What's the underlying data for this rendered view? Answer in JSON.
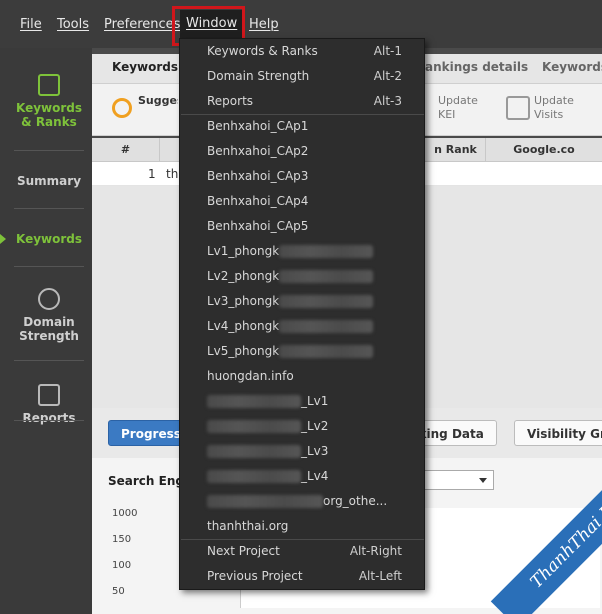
{
  "menubar": {
    "items": [
      "File",
      "Tools",
      "Preferences",
      "Window",
      "Help"
    ]
  },
  "sidebar": {
    "items": [
      {
        "label": "Keywords & Ranks",
        "icon": "chart-icon"
      },
      {
        "label": "Summary",
        "icon": ""
      },
      {
        "label": "Keywords",
        "icon": ""
      },
      {
        "label": "Domain Strength",
        "icon": "gauge-icon"
      },
      {
        "label": "Reports",
        "icon": "report-icon"
      }
    ]
  },
  "tabs": [
    "Keywords &",
    "ankings details",
    "Keywords"
  ],
  "toolbar": {
    "suggest": "Suggest Keyword",
    "update_kei": "Update KEI",
    "update_visits": "Update Visits"
  },
  "grid": {
    "headers": [
      "#",
      "n Rank",
      "Google.co"
    ],
    "row": {
      "num": "1",
      "keyword": "tha"
    }
  },
  "bottom": {
    "tabs": [
      "Progress",
      "nking Data",
      "Visibility Gra"
    ],
    "search_label": "Search Engin",
    "yticks": [
      "1000",
      "150",
      "100",
      "50"
    ]
  },
  "dropdown": {
    "top_items": [
      {
        "label": "Keywords & Ranks",
        "shortcut": "Alt-1"
      },
      {
        "label": "Domain Strength",
        "shortcut": "Alt-2"
      },
      {
        "label": "Reports",
        "shortcut": "Alt-3"
      }
    ],
    "projects": [
      {
        "label": "Benhxahoi_CAp1"
      },
      {
        "label": "Benhxahoi_CAp2"
      },
      {
        "label": "Benhxahoi_CAp3"
      },
      {
        "label": "Benhxahoi_CAp4"
      },
      {
        "label": "Benhxahoi_CAp5"
      },
      {
        "label": "Lv1_phongk"
      },
      {
        "label": "Lv2_phongk"
      },
      {
        "label": "Lv3_phongk"
      },
      {
        "label": "Lv4_phongk"
      },
      {
        "label": "Lv5_phongk"
      },
      {
        "label": "huongdan.info"
      },
      {
        "label": "_Lv1"
      },
      {
        "label": "_Lv2"
      },
      {
        "label": "_Lv3"
      },
      {
        "label": "_Lv4"
      },
      {
        "label": "org_othe..."
      },
      {
        "label": "thanhthai.org"
      }
    ],
    "nav_items": [
      {
        "label": "Next Project",
        "shortcut": "Alt-Right"
      },
      {
        "label": "Previous Project",
        "shortcut": "Alt-Left"
      }
    ]
  },
  "watermark": "ThanhThai Blog",
  "colors": {
    "accent_green": "#7ec23a",
    "highlight_red": "#d0161b",
    "progress_blue": "#3b7ac3"
  }
}
